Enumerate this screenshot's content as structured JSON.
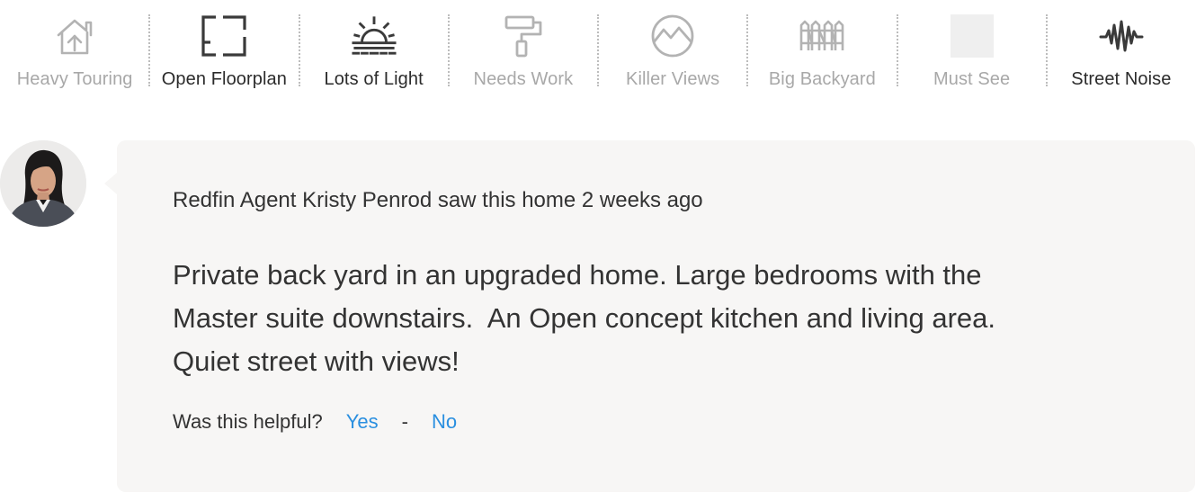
{
  "tags": [
    {
      "label": "Heavy Touring",
      "icon": "house-arrow-icon",
      "active": false
    },
    {
      "label": "Open Floorplan",
      "icon": "floorplan-icon",
      "active": true
    },
    {
      "label": "Lots of Light",
      "icon": "sunrise-icon",
      "active": true
    },
    {
      "label": "Needs Work",
      "icon": "paint-roller-icon",
      "active": false
    },
    {
      "label": "Killer Views",
      "icon": "mountain-view-icon",
      "active": false
    },
    {
      "label": "Big Backyard",
      "icon": "fence-icon",
      "active": false
    },
    {
      "label": "Must See",
      "icon": "must-see-icon",
      "active": false
    },
    {
      "label": "Street Noise",
      "icon": "sound-wave-icon",
      "active": true
    }
  ],
  "review": {
    "header": "Redfin Agent Kristy Penrod saw this home 2 weeks ago",
    "body": "Private back yard in an upgraded home. Large bedrooms with the\nMaster suite downstairs.  An Open concept kitchen and living area.\nQuiet street with views!",
    "feedback_label": "Was this helpful?",
    "yes_label": "Yes",
    "separator": "-",
    "no_label": "No"
  },
  "colors": {
    "card_bg": "#f7f6f5",
    "link": "#2a8fe0",
    "inactive": "#a8a8a8",
    "active": "#2b2b2b"
  }
}
